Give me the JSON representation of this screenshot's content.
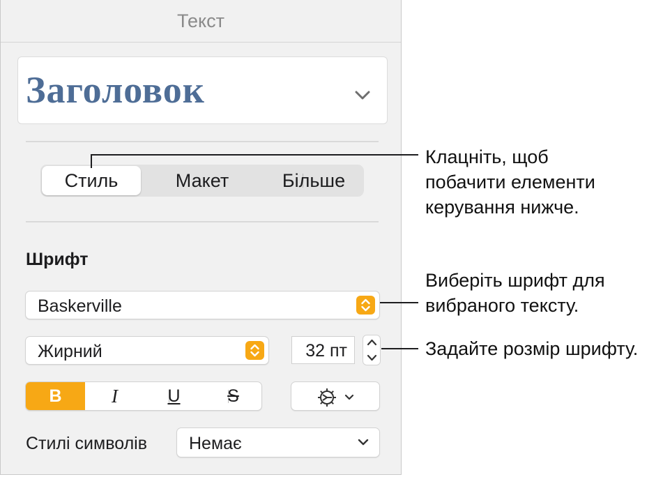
{
  "panel": {
    "title": "Текст",
    "paragraph_style": "Заголовок",
    "tabs": [
      {
        "label": "Стиль",
        "active": true
      },
      {
        "label": "Макет",
        "active": false
      },
      {
        "label": "Більше",
        "active": false
      }
    ],
    "font_section": {
      "title": "Шрифт",
      "font_family": "Baskerville",
      "typeface": "Жирний",
      "size": "32 пт",
      "format_buttons": {
        "bold": "B",
        "italic": "I",
        "underline": "U",
        "strikethrough": "S"
      },
      "gear_icon": "gear-icon",
      "character_styles_label": "Стилі символів",
      "character_style_value": "Немає"
    }
  },
  "callouts": {
    "tabs": [
      "Клацніть, щоб",
      "побачити елементи",
      "керування нижче."
    ],
    "font": [
      "Виберіть шрифт для",
      "вибраного тексту."
    ],
    "size": [
      "Задайте розмір шрифту."
    ]
  },
  "colors": {
    "accent": "#f7a815",
    "style_text": "#4e6d96",
    "panel_background": "#f1f1f1"
  }
}
